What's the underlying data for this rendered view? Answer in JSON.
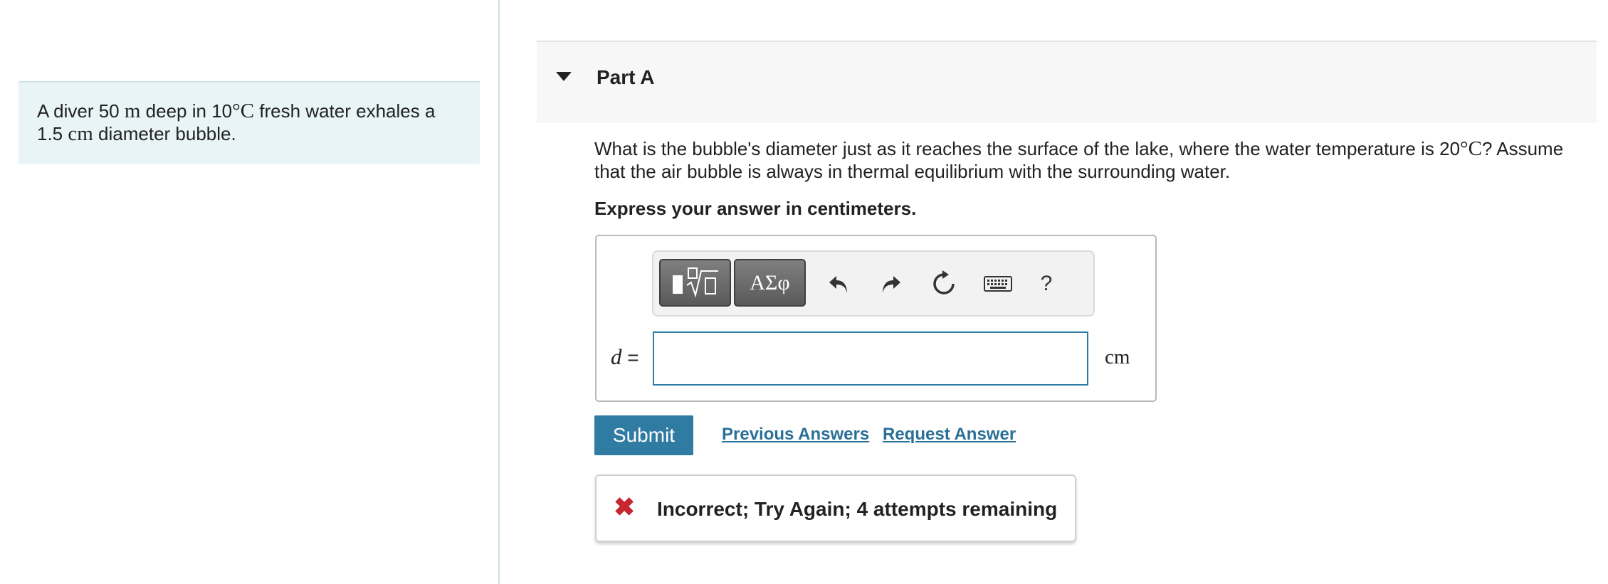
{
  "problem": {
    "text_a": "A diver ",
    "depth": "50",
    "depth_unit": "m",
    "text_b": " deep in ",
    "temp": "10",
    "temp_unit": "°C",
    "text_c": " fresh water exhales a ",
    "diameter": "1.5",
    "diameter_unit": "cm",
    "text_d": " diameter bubble."
  },
  "part": {
    "title": "Part A"
  },
  "question": {
    "text_a": "What is the bubble's diameter just as it reaches the surface of the lake, where the water temperature is ",
    "temp": "20",
    "temp_unit": "°C",
    "text_b": "? Assume that the air bubble is always in thermal equilibrium with the surrounding water.",
    "instruction": "Express your answer in centimeters."
  },
  "toolbar": {
    "templates_icon": "templates-sqrt-icon",
    "symbols_label": "ΑΣφ",
    "undo_icon": "undo-icon",
    "redo_icon": "redo-icon",
    "reset_icon": "reset-icon",
    "keyboard_icon": "keyboard-icon",
    "help_label": "?"
  },
  "answer": {
    "variable": "d",
    "equals": " =",
    "value": "",
    "unit": "cm"
  },
  "actions": {
    "submit_label": "Submit",
    "previous_answers_label": "Previous Answers",
    "request_answer_label": "Request Answer"
  },
  "feedback": {
    "icon": "✖",
    "message": "Incorrect; Try Again; 4 attempts remaining",
    "color": "#c6262e"
  },
  "colors": {
    "accent": "#2f7ba1",
    "link": "#2a6f97",
    "problem_bg": "#e8f4f5"
  }
}
